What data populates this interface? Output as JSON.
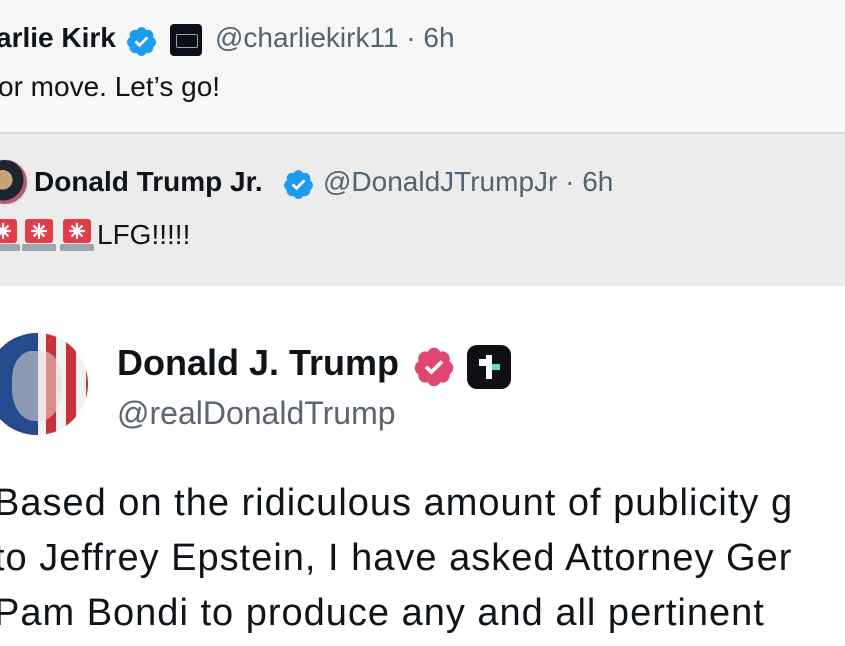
{
  "quote1": {
    "author_name": "arlie Kirk",
    "org_badge_icon": "org-affiliation-badge",
    "handle_time": "@charliekirk11 · 6h",
    "text": "or move. Let’s go!"
  },
  "quote2": {
    "author_name": "Donald Trump Jr.",
    "handle_time": "@DonaldJTrumpJr · 6h",
    "emoji_icons": [
      "rotating-light-icon",
      "rotating-light-icon",
      "rotating-light-icon"
    ],
    "text": "LFG!!!!!"
  },
  "post": {
    "author_name": "Donald J. Trump",
    "handle": "@realDonaldTrump",
    "lines": [
      "Based on the ridiculous amount of publicity g",
      "to Jeffrey Epstein, I have asked Attorney Ger",
      "Pam Bondi to produce any and all pertinent"
    ]
  },
  "colors": {
    "verified_blue": "#1d9bf0",
    "truth_verified_pink": "#e0476c",
    "handle_gray": "#536471"
  }
}
